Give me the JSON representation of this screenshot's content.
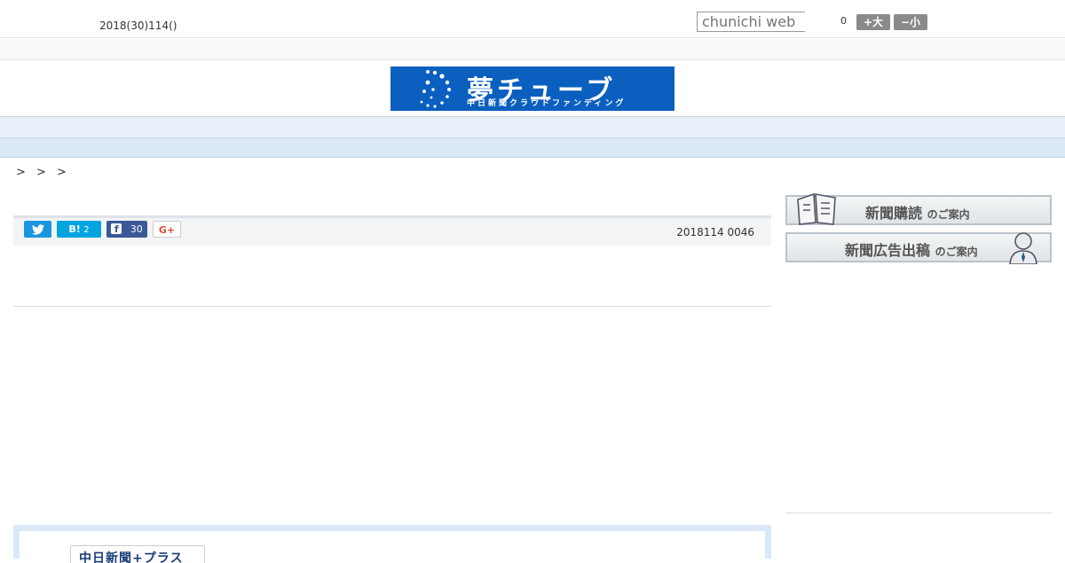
{
  "header": {
    "date": "2018(30)114()",
    "search_placeholder": "chunichi web",
    "counter": "0",
    "font_larger": "+大",
    "font_smaller": "−小"
  },
  "logo": {
    "title": "夢チューブ",
    "subtitle": "中日新聞クラウドファンディング",
    "bg_color": "#0a5fbf"
  },
  "nav": {
    "items": [
      "",
      "",
      "",
      "",
      "",
      "",
      "",
      "",
      ""
    ]
  },
  "breadcrumb": "> > >",
  "share": {
    "twitter_icon": "twitter-bird",
    "hatena_label": "B!",
    "hatena_count": "2",
    "facebook_label": "f",
    "facebook_count": "30",
    "gplus_label": "G+"
  },
  "article": {
    "published": "2018114 0046"
  },
  "sidebar": {
    "banner1": {
      "main": "新聞購読",
      "suffix": "のご案内"
    },
    "banner2": {
      "main": "新聞広告出稿",
      "suffix": "のご案内"
    }
  },
  "promo": {
    "logo_text": "中日新聞+プラス"
  }
}
